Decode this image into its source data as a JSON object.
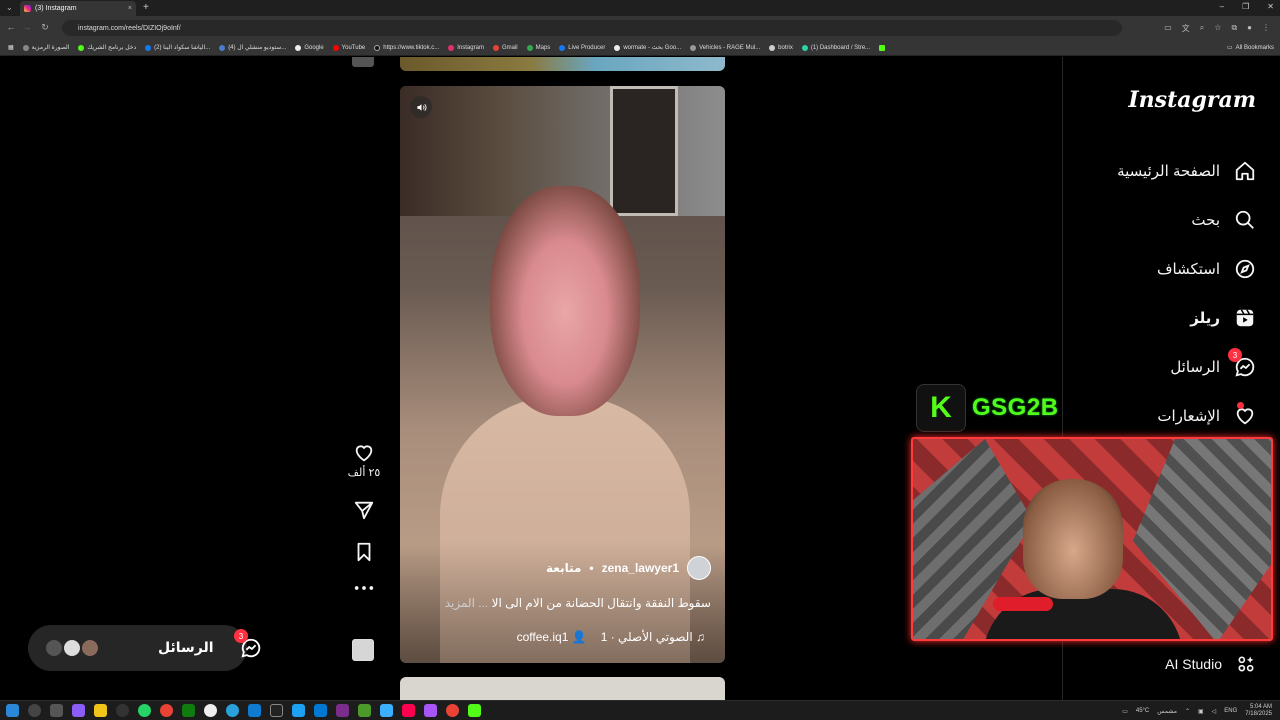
{
  "browser": {
    "tab_title": "(3) Instagram",
    "tab_close": "×",
    "new_tab": "+",
    "url": "instagram.com/reels/DIZIOj9oInf/",
    "window_controls": [
      "–",
      "❐",
      "✕"
    ],
    "bookmarks": [
      "الصورة الرمزية",
      "دخل برنامج الشريك",
      "(2) الياشا سكواد الينا...",
      "(4) ستوديو منشلي ال...",
      "Google",
      "YouTube",
      "https://www.tiktok.c...",
      "Instagram",
      "Gmail",
      "Maps",
      "Live Producer",
      "wormate - بحث Goo...",
      "Vehicles - RAGE Mul...",
      "botrix",
      "(1) Dashboard / Stre..."
    ],
    "all_bookmarks": "All Bookmarks"
  },
  "sidebar": {
    "logo": "Instagram",
    "items": [
      {
        "label": "الصفحة الرئيسية",
        "icon": "home-icon"
      },
      {
        "label": "بحث",
        "icon": "search-icon"
      },
      {
        "label": "استكشاف",
        "icon": "compass-icon"
      },
      {
        "label": "ريلز",
        "icon": "reels-icon"
      },
      {
        "label": "الرسائل",
        "icon": "messenger-icon",
        "badge": "3"
      },
      {
        "label": "الإشعارات",
        "icon": "heart-icon"
      }
    ],
    "ai_studio": "AI Studio"
  },
  "reel": {
    "username": "zena_lawyer1",
    "separator": "•",
    "follow": "متابعة",
    "caption": "سقوط النفقة وانتقال الحضانة من الام الى الا",
    "more": "... المزيد",
    "audio": "الصوتي الأصلي · 1",
    "tagged_user": "coffee.iq1",
    "likes": "٢٥ ألف"
  },
  "messages_pill": {
    "label": "الرسائل",
    "badge": "3"
  },
  "overlay": {
    "brand_letter": "K",
    "brand_name": "GSG2B"
  },
  "taskbar": {
    "weather": "45°C",
    "weather_label": "مشمس",
    "lang": "ENG",
    "time": "5:04 AM",
    "date": "7/18/2025"
  },
  "colors": {
    "accent_badge": "#ff3040",
    "kick_green": "#53fc18",
    "webcam_border": "#ff3b3b"
  }
}
